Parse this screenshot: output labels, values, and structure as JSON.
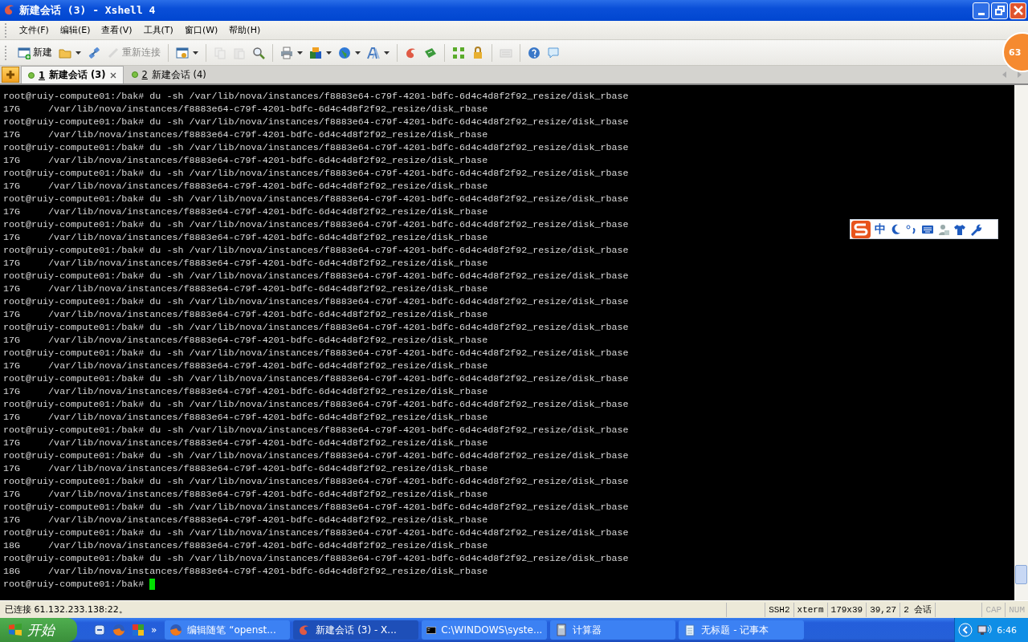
{
  "window": {
    "title": "新建会话 (3) - Xshell 4"
  },
  "menu": [
    "文件(F)",
    "编辑(E)",
    "查看(V)",
    "工具(T)",
    "窗口(W)",
    "帮助(H)"
  ],
  "toolbar": [
    {
      "kind": "button",
      "label": "新建",
      "dropdown": false,
      "disabled": false
    },
    {
      "kind": "icon",
      "dropdown": true,
      "disabled": false
    },
    {
      "kind": "icon",
      "dropdown": false,
      "disabled": false
    },
    {
      "kind": "button",
      "label": "重新连接",
      "dropdown": false,
      "disabled": true
    },
    {
      "kind": "separator"
    },
    {
      "kind": "icon",
      "dropdown": true,
      "disabled": false
    },
    {
      "kind": "separator"
    },
    {
      "kind": "icon",
      "dropdown": false,
      "disabled": true
    },
    {
      "kind": "icon",
      "dropdown": false,
      "disabled": true
    },
    {
      "kind": "icon",
      "dropdown": false,
      "disabled": false
    },
    {
      "kind": "separator"
    },
    {
      "kind": "icon",
      "dropdown": true,
      "disabled": false
    },
    {
      "kind": "icon",
      "dropdown": true,
      "disabled": false
    },
    {
      "kind": "icon",
      "dropdown": true,
      "disabled": false
    },
    {
      "kind": "icon",
      "dropdown": true,
      "disabled": false
    },
    {
      "kind": "separator"
    },
    {
      "kind": "icon",
      "dropdown": false,
      "disabled": false
    },
    {
      "kind": "icon",
      "dropdown": false,
      "disabled": false
    },
    {
      "kind": "separator"
    },
    {
      "kind": "icon",
      "dropdown": false,
      "disabled": false
    },
    {
      "kind": "icon",
      "dropdown": false,
      "disabled": false
    },
    {
      "kind": "separator"
    },
    {
      "kind": "icon",
      "dropdown": false,
      "disabled": true
    },
    {
      "kind": "separator"
    },
    {
      "kind": "icon",
      "dropdown": false,
      "disabled": false
    },
    {
      "kind": "icon",
      "dropdown": false,
      "disabled": false
    }
  ],
  "float_badge": "63",
  "tabs": [
    {
      "number": "1",
      "label": "新建会话 (3)",
      "selected": true
    },
    {
      "number": "2",
      "label": "新建会话 (4)",
      "selected": false
    }
  ],
  "terminal": {
    "lines": [
      "root@ruiy-compute01:/bak# du -sh /var/lib/nova/instances/f8883e64-c79f-4201-bdfc-6d4c4d8f2f92_resize/disk_rbase",
      "17G     /var/lib/nova/instances/f8883e64-c79f-4201-bdfc-6d4c4d8f2f92_resize/disk_rbase",
      "root@ruiy-compute01:/bak# du -sh /var/lib/nova/instances/f8883e64-c79f-4201-bdfc-6d4c4d8f2f92_resize/disk_rbase",
      "17G     /var/lib/nova/instances/f8883e64-c79f-4201-bdfc-6d4c4d8f2f92_resize/disk_rbase",
      "root@ruiy-compute01:/bak# du -sh /var/lib/nova/instances/f8883e64-c79f-4201-bdfc-6d4c4d8f2f92_resize/disk_rbase",
      "17G     /var/lib/nova/instances/f8883e64-c79f-4201-bdfc-6d4c4d8f2f92_resize/disk_rbase",
      "root@ruiy-compute01:/bak# du -sh /var/lib/nova/instances/f8883e64-c79f-4201-bdfc-6d4c4d8f2f92_resize/disk_rbase",
      "17G     /var/lib/nova/instances/f8883e64-c79f-4201-bdfc-6d4c4d8f2f92_resize/disk_rbase",
      "root@ruiy-compute01:/bak# du -sh /var/lib/nova/instances/f8883e64-c79f-4201-bdfc-6d4c4d8f2f92_resize/disk_rbase",
      "17G     /var/lib/nova/instances/f8883e64-c79f-4201-bdfc-6d4c4d8f2f92_resize/disk_rbase",
      "root@ruiy-compute01:/bak# du -sh /var/lib/nova/instances/f8883e64-c79f-4201-bdfc-6d4c4d8f2f92_resize/disk_rbase",
      "17G     /var/lib/nova/instances/f8883e64-c79f-4201-bdfc-6d4c4d8f2f92_resize/disk_rbase",
      "root@ruiy-compute01:/bak# du -sh /var/lib/nova/instances/f8883e64-c79f-4201-bdfc-6d4c4d8f2f92_resize/disk_rbase",
      "17G     /var/lib/nova/instances/f8883e64-c79f-4201-bdfc-6d4c4d8f2f92_resize/disk_rbase",
      "root@ruiy-compute01:/bak# du -sh /var/lib/nova/instances/f8883e64-c79f-4201-bdfc-6d4c4d8f2f92_resize/disk_rbase",
      "17G     /var/lib/nova/instances/f8883e64-c79f-4201-bdfc-6d4c4d8f2f92_resize/disk_rbase",
      "root@ruiy-compute01:/bak# du -sh /var/lib/nova/instances/f8883e64-c79f-4201-bdfc-6d4c4d8f2f92_resize/disk_rbase",
      "17G     /var/lib/nova/instances/f8883e64-c79f-4201-bdfc-6d4c4d8f2f92_resize/disk_rbase",
      "root@ruiy-compute01:/bak# du -sh /var/lib/nova/instances/f8883e64-c79f-4201-bdfc-6d4c4d8f2f92_resize/disk_rbase",
      "17G     /var/lib/nova/instances/f8883e64-c79f-4201-bdfc-6d4c4d8f2f92_resize/disk_rbase",
      "root@ruiy-compute01:/bak# du -sh /var/lib/nova/instances/f8883e64-c79f-4201-bdfc-6d4c4d8f2f92_resize/disk_rbase",
      "17G     /var/lib/nova/instances/f8883e64-c79f-4201-bdfc-6d4c4d8f2f92_resize/disk_rbase",
      "root@ruiy-compute01:/bak# du -sh /var/lib/nova/instances/f8883e64-c79f-4201-bdfc-6d4c4d8f2f92_resize/disk_rbase",
      "17G     /var/lib/nova/instances/f8883e64-c79f-4201-bdfc-6d4c4d8f2f92_resize/disk_rbase",
      "root@ruiy-compute01:/bak# du -sh /var/lib/nova/instances/f8883e64-c79f-4201-bdfc-6d4c4d8f2f92_resize/disk_rbase",
      "17G     /var/lib/nova/instances/f8883e64-c79f-4201-bdfc-6d4c4d8f2f92_resize/disk_rbase",
      "root@ruiy-compute01:/bak# du -sh /var/lib/nova/instances/f8883e64-c79f-4201-bdfc-6d4c4d8f2f92_resize/disk_rbase",
      "17G     /var/lib/nova/instances/f8883e64-c79f-4201-bdfc-6d4c4d8f2f92_resize/disk_rbase",
      "root@ruiy-compute01:/bak# du -sh /var/lib/nova/instances/f8883e64-c79f-4201-bdfc-6d4c4d8f2f92_resize/disk_rbase",
      "17G     /var/lib/nova/instances/f8883e64-c79f-4201-bdfc-6d4c4d8f2f92_resize/disk_rbase",
      "root@ruiy-compute01:/bak# du -sh /var/lib/nova/instances/f8883e64-c79f-4201-bdfc-6d4c4d8f2f92_resize/disk_rbase",
      "17G     /var/lib/nova/instances/f8883e64-c79f-4201-bdfc-6d4c4d8f2f92_resize/disk_rbase",
      "root@ruiy-compute01:/bak# du -sh /var/lib/nova/instances/f8883e64-c79f-4201-bdfc-6d4c4d8f2f92_resize/disk_rbase",
      "17G     /var/lib/nova/instances/f8883e64-c79f-4201-bdfc-6d4c4d8f2f92_resize/disk_rbase",
      "root@ruiy-compute01:/bak# du -sh /var/lib/nova/instances/f8883e64-c79f-4201-bdfc-6d4c4d8f2f92_resize/disk_rbase",
      "18G     /var/lib/nova/instances/f8883e64-c79f-4201-bdfc-6d4c4d8f2f92_resize/disk_rbase",
      "root@ruiy-compute01:/bak# du -sh /var/lib/nova/instances/f8883e64-c79f-4201-bdfc-6d4c4d8f2f92_resize/disk_rbase",
      "18G     /var/lib/nova/instances/f8883e64-c79f-4201-bdfc-6d4c4d8f2f92_resize/disk_rbase"
    ],
    "prompt": "root@ruiy-compute01:/bak# "
  },
  "ime": {
    "mode": "中"
  },
  "status_bar": {
    "message": "已连接 61.132.233.138:22。",
    "fields": [
      "SSH2",
      "xterm",
      "179x39",
      "39,27",
      "2 会话"
    ],
    "indicators": [
      {
        "label": "CAP",
        "disabled": true
      },
      {
        "label": "NUM",
        "disabled": true
      }
    ]
  },
  "taskbar": {
    "start": "开始",
    "overflow": "»",
    "tasks": [
      {
        "label": "编辑随笔 “openst...",
        "selected": false
      },
      {
        "label": "新建会话 (3) - X...",
        "selected": true
      },
      {
        "label": "C:\\WINDOWS\\syste...",
        "selected": false
      },
      {
        "label": "计算器",
        "selected": false
      },
      {
        "label": "无标题 - 记事本",
        "selected": false
      }
    ],
    "clock": "6:46"
  }
}
